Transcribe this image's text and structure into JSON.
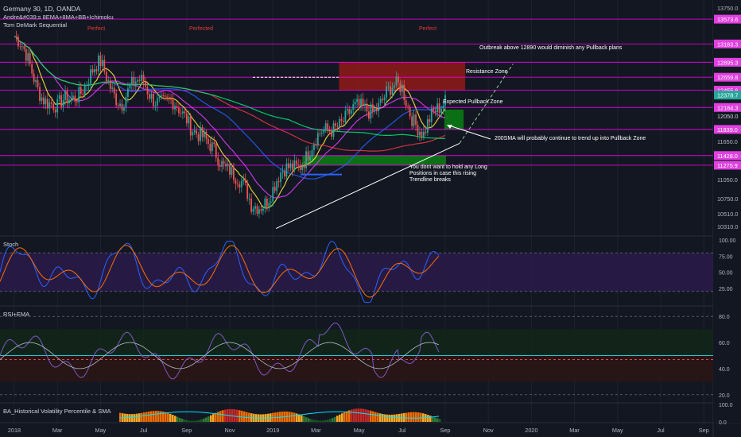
{
  "header": {
    "symbol": "Germany 30, 1D, OANDA",
    "indicator_1": "Andre&#039;s 8EMA+8MA+BB+Ichimoku",
    "indicator_2": "Tom DeMark Sequential"
  },
  "colors": {
    "background": "#131722",
    "magenta": "#ff00ff",
    "resistance_zone": "#8b1a1a",
    "pullback_zone": "#0b7a14",
    "support_zone": "#0b7a14",
    "price_label_bg": "#e040e0",
    "current_price_bg": "#26a69a",
    "red_text": "#e53935",
    "white_text": "#ffffff"
  },
  "price_axis": {
    "ticks": [
      "13750.0",
      "11650.0",
      "11050.0",
      "10750.0",
      "10510.0",
      "10310.0"
    ],
    "labels": [
      {
        "text": "13573.6",
        "value": 13573.6,
        "style": "magenta"
      },
      {
        "text": "13183.3",
        "value": 13183.3,
        "style": "magenta"
      },
      {
        "text": "12895.3",
        "value": 12895.3,
        "style": "magenta"
      },
      {
        "text": "12659.8",
        "value": 12659.8,
        "style": "magenta"
      },
      {
        "text": "12455.6",
        "value": 12455.6,
        "style": "magenta"
      },
      {
        "text": "12378.7",
        "value": 12378.7,
        "style": "current"
      },
      {
        "text": "12184.3",
        "value": 12184.3,
        "style": "magenta"
      },
      {
        "text": "12050.0",
        "value": 12050.0,
        "style": "plain"
      },
      {
        "text": "11839.0",
        "value": 11839.0,
        "style": "magenta"
      },
      {
        "text": "11428.0",
        "value": 11428.0,
        "style": "magenta"
      },
      {
        "text": "11275.9",
        "value": 11275.9,
        "style": "magenta"
      }
    ]
  },
  "time_axis": [
    "2018",
    "Mar",
    "May",
    "Jul",
    "Sep",
    "Nov",
    "2019",
    "Mar",
    "May",
    "Jul",
    "Sep",
    "Nov",
    "2020",
    "Mar",
    "May",
    "Jul",
    "Sep"
  ],
  "annotations": {
    "top_labels": [
      "Perfect",
      "Perfected",
      "Perfect"
    ],
    "outbreak": "Outbreak above 12890 would diminish any Pullback plans",
    "resistance_zone": "Resistance Zone",
    "expected_pullback": "Expected Pullback Zone",
    "sma200": "200SMA will probably continue to trend up into Pullback Zone",
    "warning_line1": "You dont want to hold any Long",
    "warning_line2": "Positions in case this rising",
    "warning_line3": "Trendline breaks"
  },
  "panels": {
    "stoch": {
      "title": "Stoch",
      "ticks": [
        "100.00",
        "75.00",
        "50.00",
        "25.00"
      ]
    },
    "rsi": {
      "title": "RSI+EMA",
      "ticks": [
        "80.0",
        "60.0",
        "40.0",
        "20.0"
      ]
    },
    "hv": {
      "title": "BA_Historical Volatility Percentile & SMA",
      "ticks": [
        "100.0",
        "0.0"
      ]
    }
  },
  "chart_data": {
    "type": "line",
    "title": "Germany 30, 1D, OANDA",
    "x_start": "2018-01",
    "x_end": "2019-09",
    "price_series": {
      "name": "",
      "x": [
        "2018-01",
        "2018-02",
        "2018-03",
        "2018-04",
        "2018-05",
        "2018-06",
        "2018-07",
        "2018-08",
        "2018-09",
        "2018-10",
        "2018-11",
        "2018-12",
        "2019-01",
        "2019-02",
        "2019-03",
        "2019-04",
        "2019-05",
        "2019-06",
        "2019-07",
        "2019-08",
        "2019-09"
      ],
      "values": [
        13300,
        12600,
        12100,
        12500,
        12800,
        12300,
        12600,
        12200,
        12100,
        11500,
        11300,
        10600,
        10900,
        11300,
        11600,
        12000,
        12100,
        12300,
        12500,
        11700,
        12378.7
      ]
    },
    "horizontal_levels": [
      13573.6,
      13183.3,
      12895.3,
      12659.8,
      12455.6,
      12184.3,
      11839.0,
      11428.0,
      11275.9
    ],
    "zones": [
      {
        "name": "Resistance Zone",
        "y_low": 12455.6,
        "y_high": 12895.3
      },
      {
        "name": "Expected Pullback Zone",
        "y_low": 11839.0,
        "y_high": 12150.0
      },
      {
        "name": "",
        "y_low": 11275.9,
        "y_high": 11428.0
      }
    ],
    "ylim": [
      10200,
      13850
    ],
    "stoch": {
      "ylim": [
        0,
        100
      ],
      "bands": [
        20,
        80
      ]
    },
    "rsi": {
      "ylim": [
        15,
        85
      ],
      "levels": [
        30,
        50,
        70
      ]
    },
    "hv": {
      "ylim": [
        0,
        100
      ]
    }
  }
}
